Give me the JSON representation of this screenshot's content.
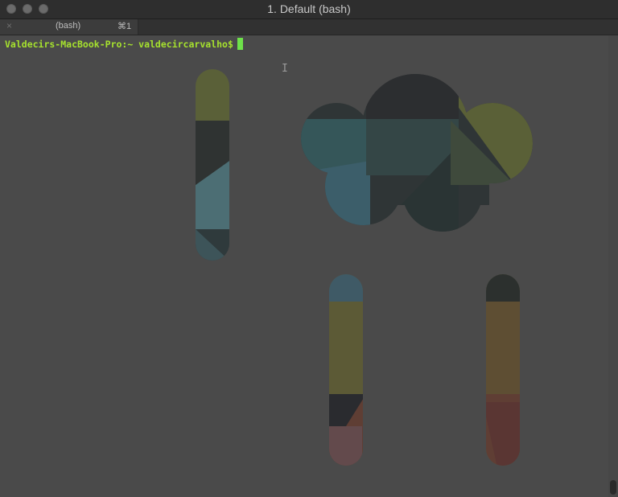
{
  "window": {
    "title": "1. Default (bash)"
  },
  "tabs": [
    {
      "close_icon": "×",
      "label": "(bash)",
      "shortcut": "⌘1"
    }
  ],
  "terminal": {
    "prompt": "Valdecirs-MacBook-Pro:~ valdecircarvalho$",
    "ibeam_glyph": "I"
  },
  "colors": {
    "prompt_green": "#a6e22e",
    "cursor_green": "#6ee24a",
    "terminal_bg": "#4a4a4a"
  }
}
